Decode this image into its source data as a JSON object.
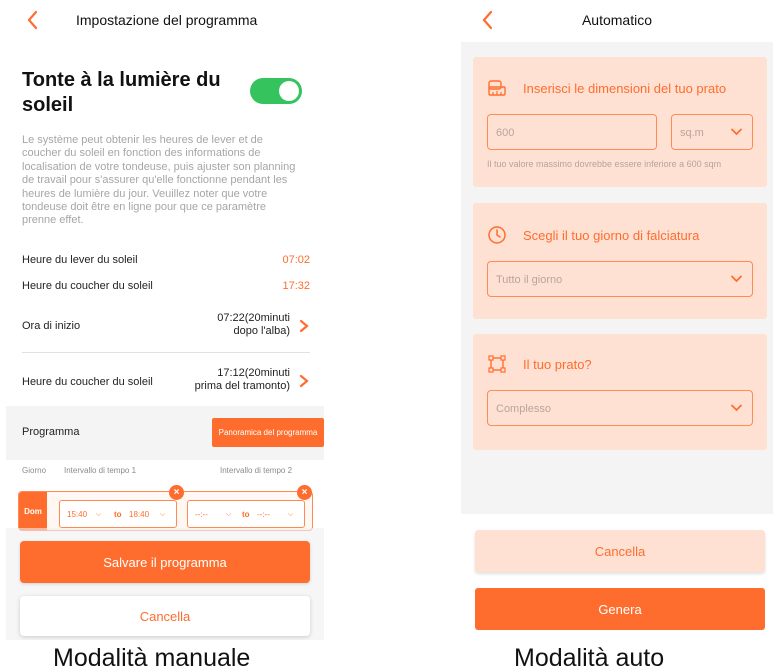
{
  "manual": {
    "header_title": "Impostazione del programma",
    "sun_title": "Tonte à la lumière du soleil",
    "toggle_on": true,
    "description": "Le système peut obtenir les heures de lever et de coucher du soleil en fonction des informations de localisation de votre tondeuse, puis ajuster son planning de travail pour s'assurer qu'elle fonctionne pendant les heures de lumière du jour. Veuillez noter que votre tondeuse doit être en ligne pour que ce paramètre prenne effet.",
    "sunrise_label": "Heure du lever du soleil",
    "sunrise_value": "07:02",
    "sunset_label": "Heure du coucher du soleil",
    "sunset_value": "17:32",
    "start_label": "Ora di inizio",
    "start_value_line1": "07:22(20minuti",
    "start_value_line2": "dopo l'alba)",
    "end_label": "Heure du coucher du soleil",
    "end_value_line1": "17:12(20minuti",
    "end_value_line2": "prima del tramonto)",
    "program_label": "Programma",
    "overview_button": "Panoramica del programma",
    "col_day": "Giorno",
    "col_interval1": "Intervallo di tempo 1",
    "col_interval2": "Intervallo di tempo 2",
    "schedule": {
      "day": "Dom",
      "slot1_from": "15:40",
      "slot1_to_word": "to",
      "slot1_to": "18:40",
      "slot2_from": "--:--",
      "slot2_to_word": "to",
      "slot2_to": "--:--",
      "remove_symbol": "×"
    },
    "save_button": "Salvare il programma",
    "cancel_button": "Cancella",
    "caption": "Modalità manuale"
  },
  "auto": {
    "header_title": "Automatico",
    "card1_title": "Inserisci le dimensioni del tuo prato",
    "size_value": "600",
    "unit_value": "sq.m",
    "hint": "Il tuo valore massimo dovrebbe essere inferiore a 600 sqm",
    "card2_title": "Scegli il tuo giorno di falciatura",
    "day_value": "Tutto il giorno",
    "card3_title": "Il tuo prato?",
    "lawn_value": "Complesso",
    "cancel_button": "Cancella",
    "generate_button": "Genera",
    "caption": "Modalità auto"
  },
  "colors": {
    "accent": "#ff6d2e",
    "toggle_green": "#35c35d",
    "card_bg": "#ffe1d3"
  },
  "icons": [
    "back-chevron-icon",
    "chevron-right-icon",
    "chevron-down-icon",
    "close-icon",
    "ruler-icon",
    "clock-icon",
    "area-frame-icon"
  ]
}
